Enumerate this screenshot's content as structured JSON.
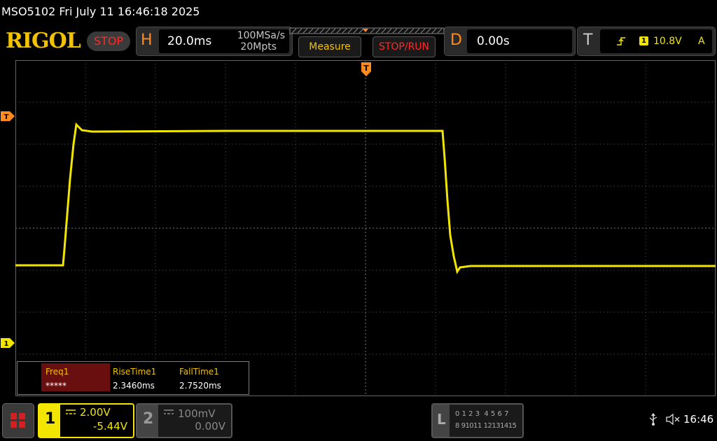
{
  "title": "MSO5102  Fri July 11 16:46:18 2025",
  "logo": "RIGOL",
  "run_state": "STOP",
  "horizontal": {
    "letter": "H",
    "timebase": "20.0ms",
    "sample_rate": "100MSa/s",
    "memory_depth": "20Mpts"
  },
  "buttons": {
    "measure": "Measure",
    "stop_run": "STOP/RUN"
  },
  "delay": {
    "letter": "D",
    "value": "0.00s"
  },
  "trigger": {
    "letter": "T",
    "channel": "1",
    "level": "10.8V",
    "mode": "A"
  },
  "markers": {
    "trigger_pos": "T",
    "trigger_level": "T",
    "ch1_ground": "1"
  },
  "measurements": {
    "headers": [
      "Freq1",
      "RiseTime1",
      "FallTime1"
    ],
    "values": [
      "*****",
      "2.3460ms",
      "2.7520ms"
    ]
  },
  "ch1": {
    "label": "1",
    "scale": "2.00V",
    "offset": "-5.44V"
  },
  "ch2": {
    "label": "2",
    "scale": "100mV",
    "offset": "0.00V"
  },
  "logic": {
    "label": "L",
    "row1": [
      "0",
      "1",
      "2",
      "3",
      "4",
      "5",
      "6",
      "7"
    ],
    "row2": [
      "8",
      "9",
      "10",
      "11",
      "12",
      "13",
      "14",
      "15"
    ]
  },
  "status": {
    "time": "16:46"
  },
  "colors": {
    "ch1": "#f2e600",
    "accent": "#ff8a1e",
    "stop": "#ff2b2b",
    "grid": "#555555"
  }
}
